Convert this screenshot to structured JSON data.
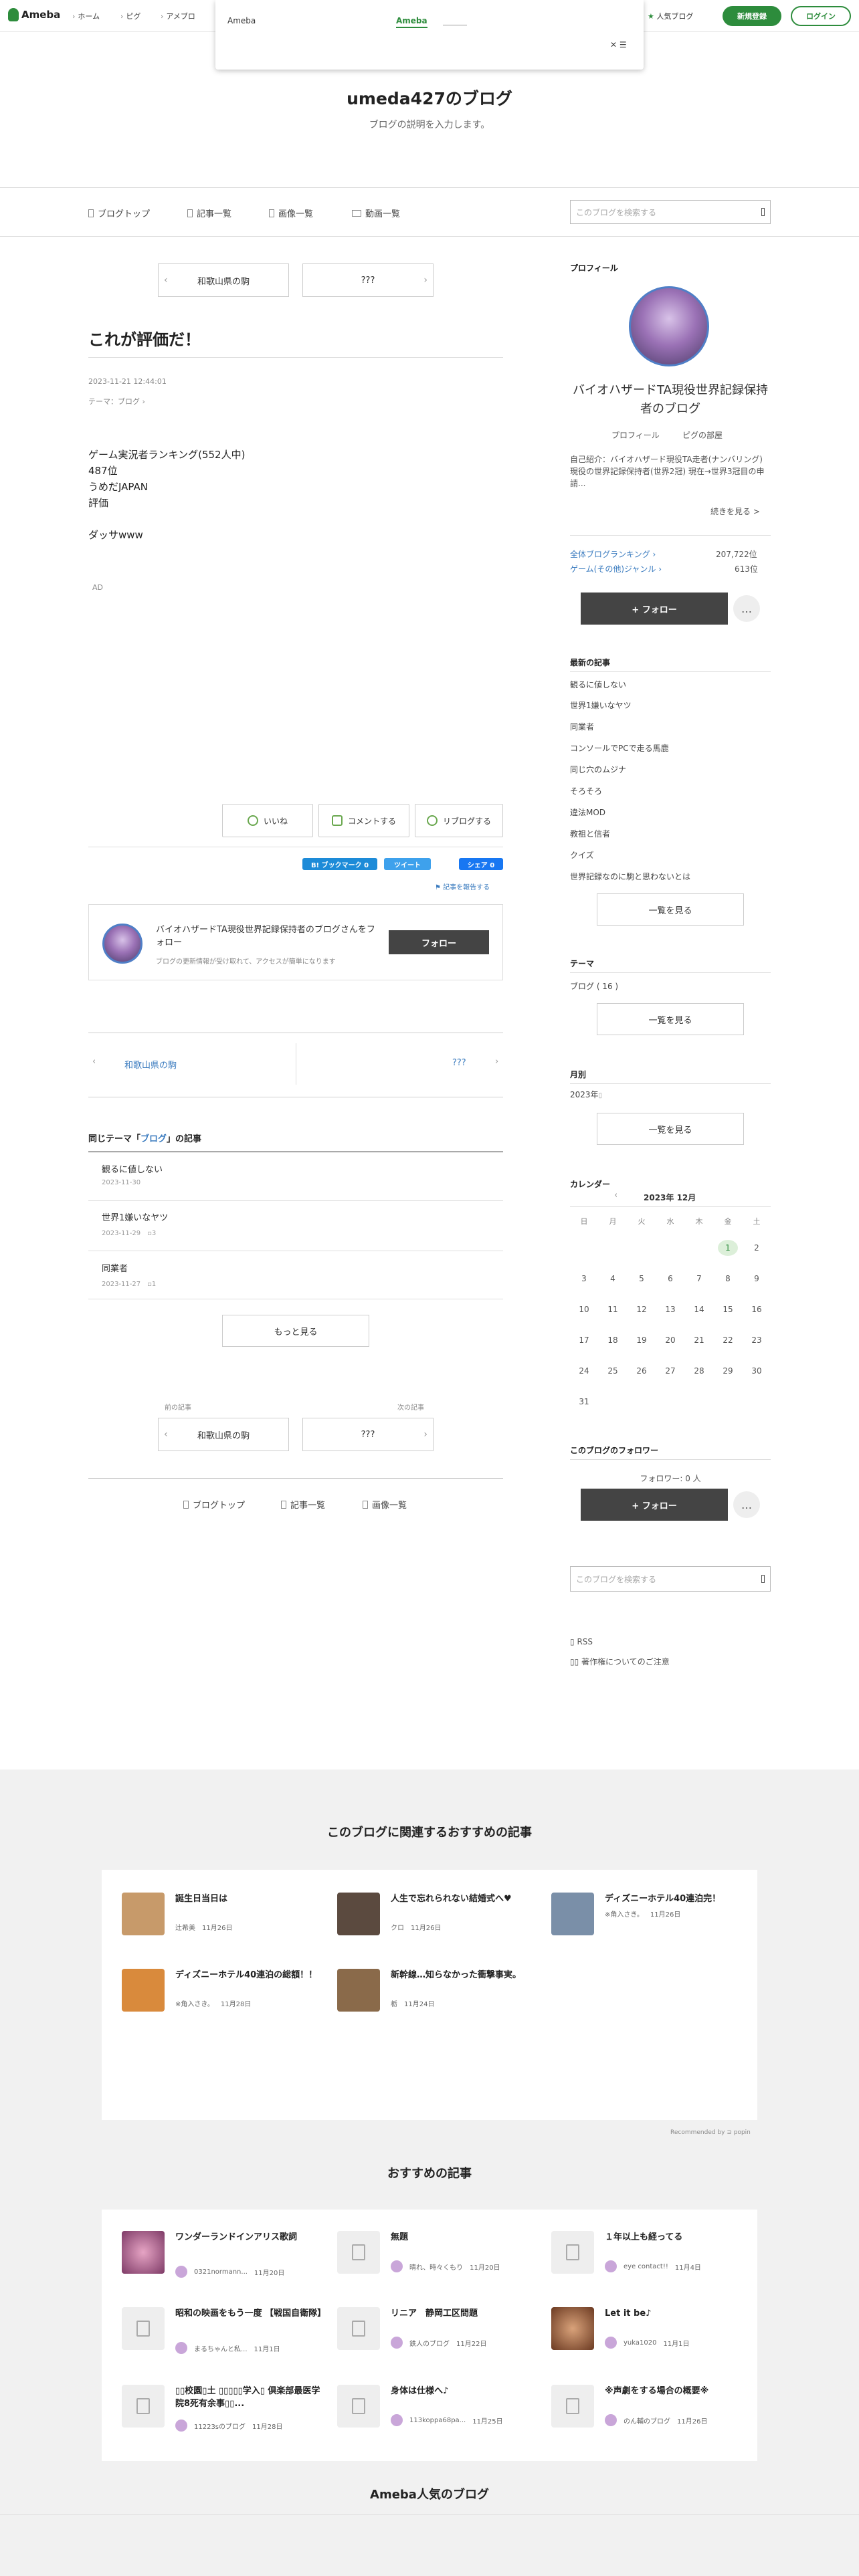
{
  "header": {
    "logo": "Ameba",
    "nav": [
      "ホーム",
      "ピグ",
      "アメブロ"
    ],
    "popular_blog": "人気ブログ",
    "signup": "新規登録",
    "login": "ログイン"
  },
  "overlay": {
    "brand": "Ameba",
    "tab_label": "Ameba",
    "close": "✕ ☰"
  },
  "blog": {
    "title": "umeda427のブログ",
    "description": "ブログの説明を入力します。"
  },
  "subnav": {
    "items": [
      "ブログトップ",
      "記事一覧",
      "画像一覧",
      "動画一覧"
    ],
    "search_placeholder": "このブログを検索する"
  },
  "pager_top": {
    "prev": "和歌山県の駒",
    "next": "???"
  },
  "article": {
    "title": "これが評価だ！",
    "datetime": "2023-11-21 12:44:01",
    "theme": "テーマ：ブログ",
    "body": [
      "ゲーム実況者ランキング(552人中)",
      "487位",
      "うめだJAPAN",
      "評価",
      "",
      "ダッサwww"
    ],
    "ad": "AD",
    "reactions": {
      "like": "いいね",
      "comment": "コメントする",
      "reblog": "リブログする"
    },
    "share": {
      "bookmark": "B! ブックマーク 0",
      "tweet": "ツイート",
      "fb": "シェア 0"
    },
    "report": "記事を報告する"
  },
  "follow_box": {
    "title": "バイオハザードTA現役世界記録保持者のブログさんをフォロー",
    "subtitle": "ブログの更新情報が受け取れて、アクセスが簡単になります",
    "button": "フォロー"
  },
  "pager_mid": {
    "prev": "和歌山県の駒",
    "next": "???"
  },
  "same_theme": {
    "heading_prefix": "同じテーマ「",
    "heading_theme": "ブログ",
    "heading_suffix": "」の記事",
    "items": [
      {
        "title": "観るに値しない",
        "date": "2023-11-30",
        "comments": ""
      },
      {
        "title": "世界1嫌いなヤツ",
        "date": "2023-11-29",
        "comments": "3"
      },
      {
        "title": "同業者",
        "date": "2023-11-27",
        "comments": "1"
      }
    ],
    "more": "もっと見る"
  },
  "pager_bottom": {
    "prev_label": "前の記事",
    "next_label": "次の記事",
    "prev": "和歌山県の駒",
    "next": "???"
  },
  "bottom_nav": [
    "ブログトップ",
    "記事一覧",
    "画像一覧"
  ],
  "sidebar": {
    "profile_heading": "プロフィール",
    "profile_name": "バイオハザードTA現役世界記録保持者のブログ",
    "profile_links": [
      "プロフィール",
      "ピグの部屋"
    ],
    "profile_text": "自己紹介：バイオハザード現役TA走者(ナンバリング) 現役の世界記録保持者(世界2冠) 現在→世界3冠目の申請...",
    "read_more": "続きを見る >",
    "ranks": [
      {
        "label": "全体ブログランキング",
        "value": "207,722位"
      },
      {
        "label": "ゲーム(その他)ジャンル",
        "value": "613位"
      }
    ],
    "follow": "+ フォロー",
    "more": "…",
    "latest_heading": "最新の記事",
    "latest": [
      "観るに値しない",
      "世界1嫌いなヤツ",
      "同業者",
      "コンソールでPCで走る馬鹿",
      "同じ穴のムジナ",
      "そろそろ",
      "違法MOD",
      "教祖と信者",
      "クイズ",
      "世界記録なのに駒と思わないとは"
    ],
    "view_all": "一覧を見る",
    "theme_heading": "テーマ",
    "theme_item": "ブログ ( 16 )",
    "month_heading": "月別",
    "month_item": "2023年",
    "calendar_heading": "カレンダー",
    "calendar_month": "2023年 12月",
    "weekdays": [
      "日",
      "月",
      "火",
      "水",
      "木",
      "金",
      "土"
    ],
    "days": [
      "",
      "",
      "",
      "",
      "",
      "1",
      "2",
      "3",
      "4",
      "5",
      "6",
      "7",
      "8",
      "9",
      "10",
      "11",
      "12",
      "13",
      "14",
      "15",
      "16",
      "17",
      "18",
      "19",
      "20",
      "21",
      "22",
      "23",
      "24",
      "25",
      "26",
      "27",
      "28",
      "29",
      "30",
      "31"
    ],
    "followers_heading": "このブログのフォロワー",
    "followers_count": "フォロワー: 0 人",
    "rss": "RSS",
    "copyright": "著作権についてのご注意"
  },
  "related": {
    "heading": "このブログに関連するおすすめの記事",
    "cards": [
      {
        "title": "誕生日当日は",
        "author": "辻希美",
        "date": "11月26日",
        "color": "#c79a6a"
      },
      {
        "title": "人生で忘れられない結婚式へ♥",
        "author": "クロ",
        "date": "11月26日",
        "color": "#5b4a3f"
      },
      {
        "title": "ディズニーホテル40連泊完！",
        "author": "※角入さき。",
        "date": "11月26日",
        "color": "#7a8fa8"
      },
      {
        "title": "ディズニーホテル40連泊の総額！！",
        "author": "※角入さき。",
        "date": "11月28日",
        "color": "#d98a3c"
      },
      {
        "title": "新幹線…知らなかった衝撃事実。",
        "author": "栃",
        "date": "11月24日",
        "color": "#8a6a4a"
      }
    ],
    "recommended_by": "Recommended by ⊇ popin"
  },
  "recommend": {
    "heading": "おすすめの記事",
    "cards": [
      {
        "title": "ワンダーランドインアリス歌詞",
        "author": "0321normann...",
        "date": "11月20日",
        "thumb": true
      },
      {
        "title": "無題",
        "author": "晴れ、時々くもり",
        "date": "11月20日",
        "thumb": false
      },
      {
        "title": "１年以上も経ってる",
        "author": "eye contact!!",
        "date": "11月4日",
        "thumb": false
      },
      {
        "title": "昭和の映画をもう一度 【戦国自衛隊】",
        "author": "まるちゃんと私...",
        "date": "11月1日",
        "thumb": false
      },
      {
        "title": "リニア　静岡工区問題",
        "author": "鉄人のブログ",
        "date": "11月22日",
        "thumb": false
      },
      {
        "title": "Let it be♪",
        "author": "yuka1020",
        "date": "11月1日",
        "thumb": true
      },
      {
        "title": "▯▯校園▯土 ▯▯▯▯▯学入▯ 倶楽部最医学院8死有余事▯▯...",
        "author": "11223sのブログ",
        "date": "11月28日",
        "thumb": false
      },
      {
        "title": "身体は仕様へ♪",
        "author": "113koppa68pa...",
        "date": "11月25日",
        "thumb": false
      },
      {
        "title": "※声劇をする場合の概要※",
        "author": "のん輔のブログ",
        "date": "11月26日",
        "thumb": false
      }
    ]
  },
  "popular_heading": "Ameba人気のブログ"
}
